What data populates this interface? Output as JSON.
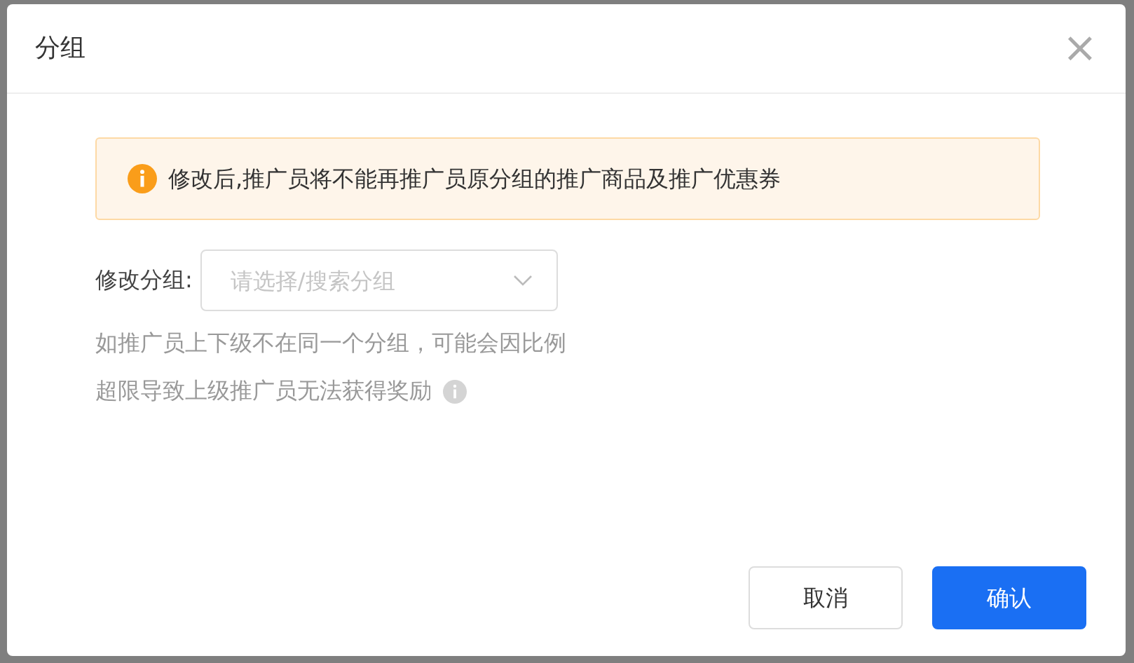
{
  "dialog": {
    "title": "分组",
    "close": "×"
  },
  "alert": {
    "text": "修改后,推广员将不能再推广员原分组的推广商品及推广优惠券"
  },
  "field": {
    "label": "修改分组:",
    "placeholder": "请选择/搜索分组"
  },
  "hint": {
    "lines": [
      "如推广员上下级不在同一个分组，可能会因比例",
      "超限导致上级推广员无法获得奖励"
    ]
  },
  "buttons": [
    {
      "label": "取消",
      "kind": "secondary"
    },
    {
      "label": "确认",
      "kind": "primary"
    }
  ]
}
